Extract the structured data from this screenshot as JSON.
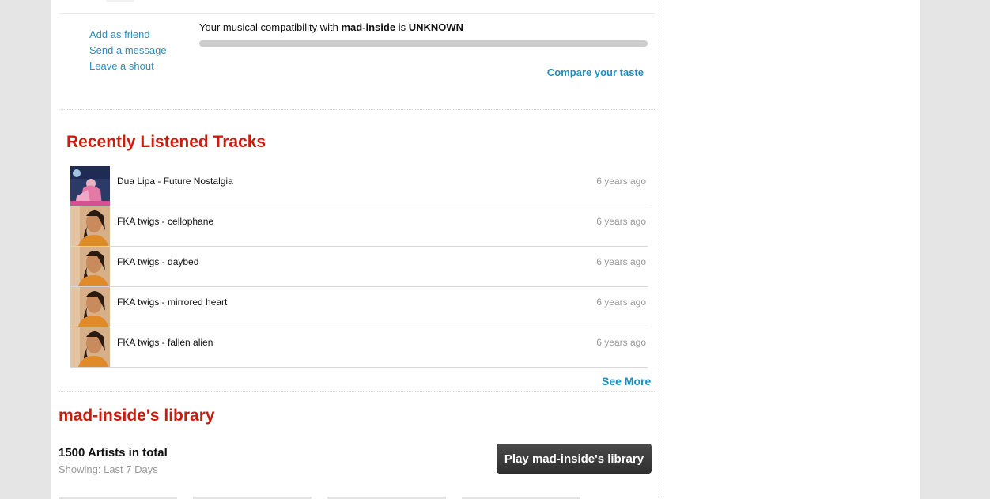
{
  "actions": {
    "add_friend": "Add as friend",
    "send_message": "Send a message",
    "leave_shout": "Leave a shout"
  },
  "compatibility": {
    "prefix": "Your musical compatibility with",
    "user": "mad-inside",
    "is": "is",
    "level": "UNKNOWN",
    "compare_label": "Compare your taste"
  },
  "recent": {
    "title": "Recently Listened Tracks",
    "tracks": [
      {
        "title": "Dua Lipa - Future Nostalgia",
        "time": "6 years ago",
        "art": "dua-lipa-cover"
      },
      {
        "title": "FKA twigs - cellophane",
        "time": "6 years ago",
        "art": "fka-twigs-photo"
      },
      {
        "title": "FKA twigs - daybed",
        "time": "6 years ago",
        "art": "fka-twigs-photo"
      },
      {
        "title": "FKA twigs - mirrored heart",
        "time": "6 years ago",
        "art": "fka-twigs-photo"
      },
      {
        "title": "FKA twigs - fallen alien",
        "time": "6 years ago",
        "art": "fka-twigs-photo"
      }
    ],
    "see_more": "See More"
  },
  "library": {
    "title": "mad-inside's library",
    "total": "1500 Artists in total",
    "showing": "Showing: Last 7 Days",
    "play_label": "Play mad-inside's library"
  },
  "colors": {
    "accent_red": "#cc1b0f",
    "link_blue": "#1a8fc0",
    "button_dark": "#3b3b3b"
  }
}
